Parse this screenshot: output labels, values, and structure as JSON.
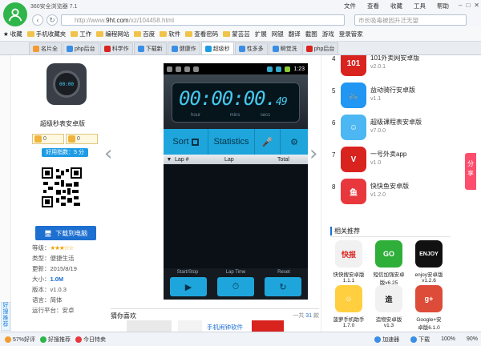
{
  "browser": {
    "title": "360安全浏览器 7.1",
    "menu": [
      "文件",
      "查看",
      "收藏",
      "工具",
      "帮助"
    ],
    "url_host": "http://www.",
    "url_domain": "9ht.com",
    "url_path": "/xz/104458.html",
    "search_placeholder": "市长吸毒被因升迁无望",
    "bookmarks": [
      "收藏",
      "手机收藏夹",
      "工作",
      "编程网站",
      "百度",
      "软件",
      "查看密码",
      "蒙芸芸",
      "扩展",
      "网银",
      "翻译",
      "截图",
      "游戏",
      "登录管家"
    ],
    "tabs": [
      "名片全",
      "php后台",
      "科学作",
      "下载新",
      "健康作",
      "超级秒",
      "性多多",
      "瞬觉洗",
      "php后台"
    ]
  },
  "left": {
    "app_name": "超级秒表安卓版",
    "vote_up": "0",
    "vote_down": "0",
    "rating": "好用指数：5 分",
    "download": "下载到电脑",
    "meta": [
      {
        "k": "等级：",
        "v": "★★★☆☆",
        "kind": "stars"
      },
      {
        "k": "类型：",
        "v": "便捷生活",
        "kind": "text"
      },
      {
        "k": "更新：",
        "v": "2015/8/19",
        "kind": "text"
      },
      {
        "k": "大小：",
        "v": "1.0M",
        "kind": "bold"
      },
      {
        "k": "版本：",
        "v": "v1.0.3",
        "kind": "text"
      },
      {
        "k": "语言：",
        "v": "简体",
        "kind": "text"
      },
      {
        "k": "运行平台：",
        "v": "安卓",
        "kind": "text"
      }
    ],
    "side_tag": "好搜推荐"
  },
  "phone": {
    "clock": "1:23",
    "time_main": "00:00:00.",
    "time_ms": "49",
    "units": [
      "hour",
      "mins",
      "secs"
    ],
    "sort": "Sort",
    "statistics": "Statistics",
    "cols": [
      "Lap #",
      "Lap",
      "Total"
    ],
    "bottom_labels": [
      "Start/Stop",
      "Lap Time",
      "Reset"
    ]
  },
  "rank": [
    {
      "num": "4",
      "name": "101外卖网安卓版",
      "ver": "v2.0.1",
      "color": "#d8231f",
      "glyph": "101"
    },
    {
      "num": "5",
      "name": "益动骑行安卓版",
      "ver": "v1.1",
      "color": "#2196f3",
      "glyph": "🚲"
    },
    {
      "num": "6",
      "name": "超级课程表安卓版",
      "ver": "v7.0.0",
      "color": "#4cb7f2",
      "glyph": "☺"
    },
    {
      "num": "7",
      "name": "一号外卖app",
      "ver": "v1.0",
      "color": "#d8231f",
      "glyph": "V"
    },
    {
      "num": "8",
      "name": "快快鱼安卓版",
      "ver": "v1.2.0",
      "color": "#e8383d",
      "glyph": "鱼"
    }
  ],
  "recommend": {
    "title": "相关推荐",
    "items": [
      {
        "name": "快快搜安卓版",
        "ver": "1.1.1",
        "color": "#f1f1f1",
        "glyph": "快报",
        "fg": "#d8231f"
      },
      {
        "name": "短信加强安卓",
        "ver": "版v6.25",
        "color": "#2fae3a",
        "glyph": "GO",
        "fg": "#fff"
      },
      {
        "name": "enjoy安卓版",
        "ver": "v1.2.6",
        "color": "#111",
        "glyph": "ENJOY",
        "fg": "#fff"
      },
      {
        "name": "菠萝手机助手",
        "ver": "1.7.0",
        "color": "#ffcf3f",
        "glyph": "☺",
        "fg": "#fff"
      },
      {
        "name": "造物安卓版",
        "ver": "v1.3",
        "color": "#f1f1f1",
        "glyph": "造",
        "fg": "#111"
      },
      {
        "name": "Google+安",
        "ver": "卓版6.1.0",
        "color": "#dd4b39",
        "glyph": "g+",
        "fg": "#fff"
      }
    ]
  },
  "guess": {
    "title": "猜你喜欢",
    "count_prefix": "一共",
    "count": "31",
    "count_suffix": "款",
    "thumb_text": "手机闹钟软件"
  },
  "share": "分享",
  "status": {
    "items": [
      "57%好评",
      "好搜推荐",
      "今日特卖"
    ],
    "right": [
      "加速器",
      "下载",
      "100%",
      "90%"
    ]
  }
}
